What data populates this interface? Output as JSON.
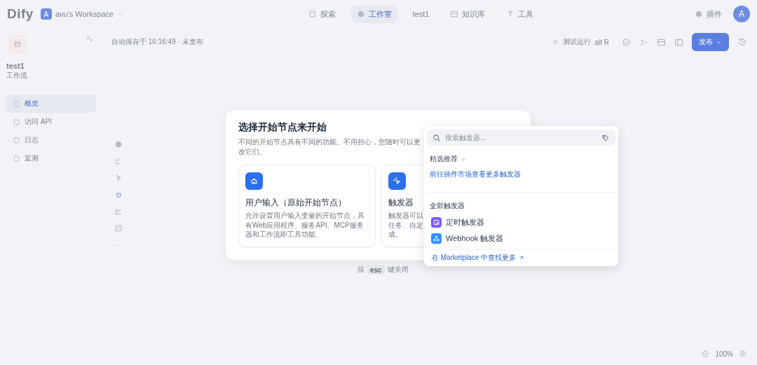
{
  "header": {
    "logo": "Dify",
    "workspace_initial": "A",
    "workspace_name": "avu's Workspace",
    "nav": [
      {
        "label": "探索",
        "selected": false
      },
      {
        "label": "工作室",
        "selected": true
      },
      {
        "label": "test1",
        "selected": false
      },
      {
        "label": "知识库",
        "selected": false
      },
      {
        "label": "工具",
        "selected": false
      }
    ],
    "plugins": "插件",
    "avatar": "A"
  },
  "sidebar": {
    "app_name": "test1",
    "app_type": "工作流",
    "items": [
      {
        "label": "概览",
        "selected": true
      },
      {
        "label": "访问 API",
        "selected": false
      },
      {
        "label": "日志",
        "selected": false
      },
      {
        "label": "监测",
        "selected": false
      }
    ]
  },
  "toolbar": {
    "status": "自动保存于 16:16:49 · 未发布",
    "run": "测试运行",
    "shortcut": "alt R",
    "publish": "发布"
  },
  "footer": {
    "zoom": "100%"
  },
  "modal": {
    "title": "选择开始节点来开始",
    "subtitle": "不同的开始节点具有不同的功能。不用担心，您随时可以更改它们。",
    "cards": [
      {
        "kind": "home",
        "title": "用户输入（原始开始节点）",
        "description_lines": [
          "允许设置用户输入变量的开始节点，具有Web应用程序、服务API、MCP服务器和工作流即工具功能。"
        ]
      },
      {
        "kind": "trigger",
        "title": "触发器",
        "description_lines": [
          "触发器可以",
          "任务、自定",
          "成。"
        ]
      }
    ],
    "hint_before": "按",
    "hint_key": "esc",
    "hint_after": "键关闭"
  },
  "dropdown": {
    "search": {
      "placeholder": "搜索触发器..."
    },
    "featured_heading": "精选推荐",
    "featured_link": "前往插件市场查看更多触发器",
    "all_heading": "全部触发器",
    "items": [
      {
        "kind": "schedule",
        "label": "定时触发器",
        "color": "#7a5af8"
      },
      {
        "kind": "webhook",
        "label": "Webhook 触发器",
        "color": "#2e90fa"
      }
    ],
    "footer_link": "在 Marketplace 中查找更多"
  }
}
